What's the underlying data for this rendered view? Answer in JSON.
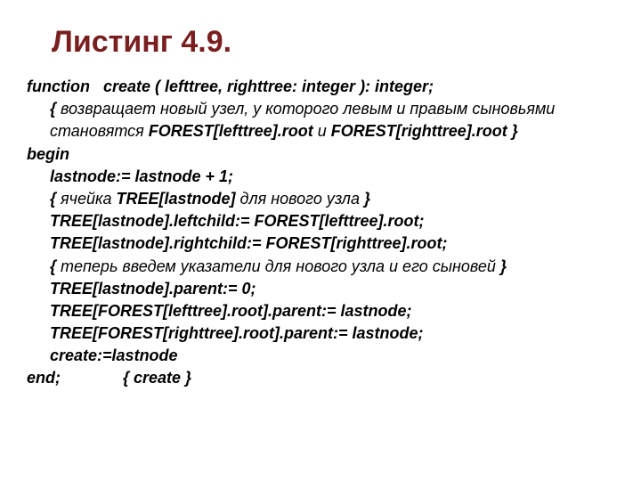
{
  "title": "Листинг 4.9.",
  "code": {
    "l1": "function   create ( lefttree, righttree: integer ): integer;",
    "l2a": "{ ",
    "l2b": "возвращает новый узел, у которого левым и правым сыновьями",
    "l3a": "становятся",
    "l3b": " FOREST[lefttree].root ",
    "l3c": "и",
    "l3d": " FOREST[righttree].root ",
    "l3e": "}",
    "l4": "begin",
    "l5": "lastnode:= lastnode + 1;",
    "l6a": "{ ",
    "l6b": "ячейка",
    "l6c": " TREE[lastnode] ",
    "l6d": "для нового узла",
    "l6e": " }",
    "l7": "TREE[lastnode].leftchild:= FOREST[lefttree].root;",
    "l8": "TREE[lastnode].rightchild:= FOREST[righttree].root;",
    "l9a": "{ ",
    "l9b": "теперь введем указатели для нового узла и его сыновей",
    "l9c": " }",
    "l10": "TREE[lastnode].parent:= 0;",
    "l11": "TREE[FOREST[lefttree].root].parent:= lastnode;",
    "l12": "TREE[FOREST[righttree].root].parent:= lastnode;",
    "l13": "create:=lastnode",
    "l14": "end;              { create }"
  }
}
